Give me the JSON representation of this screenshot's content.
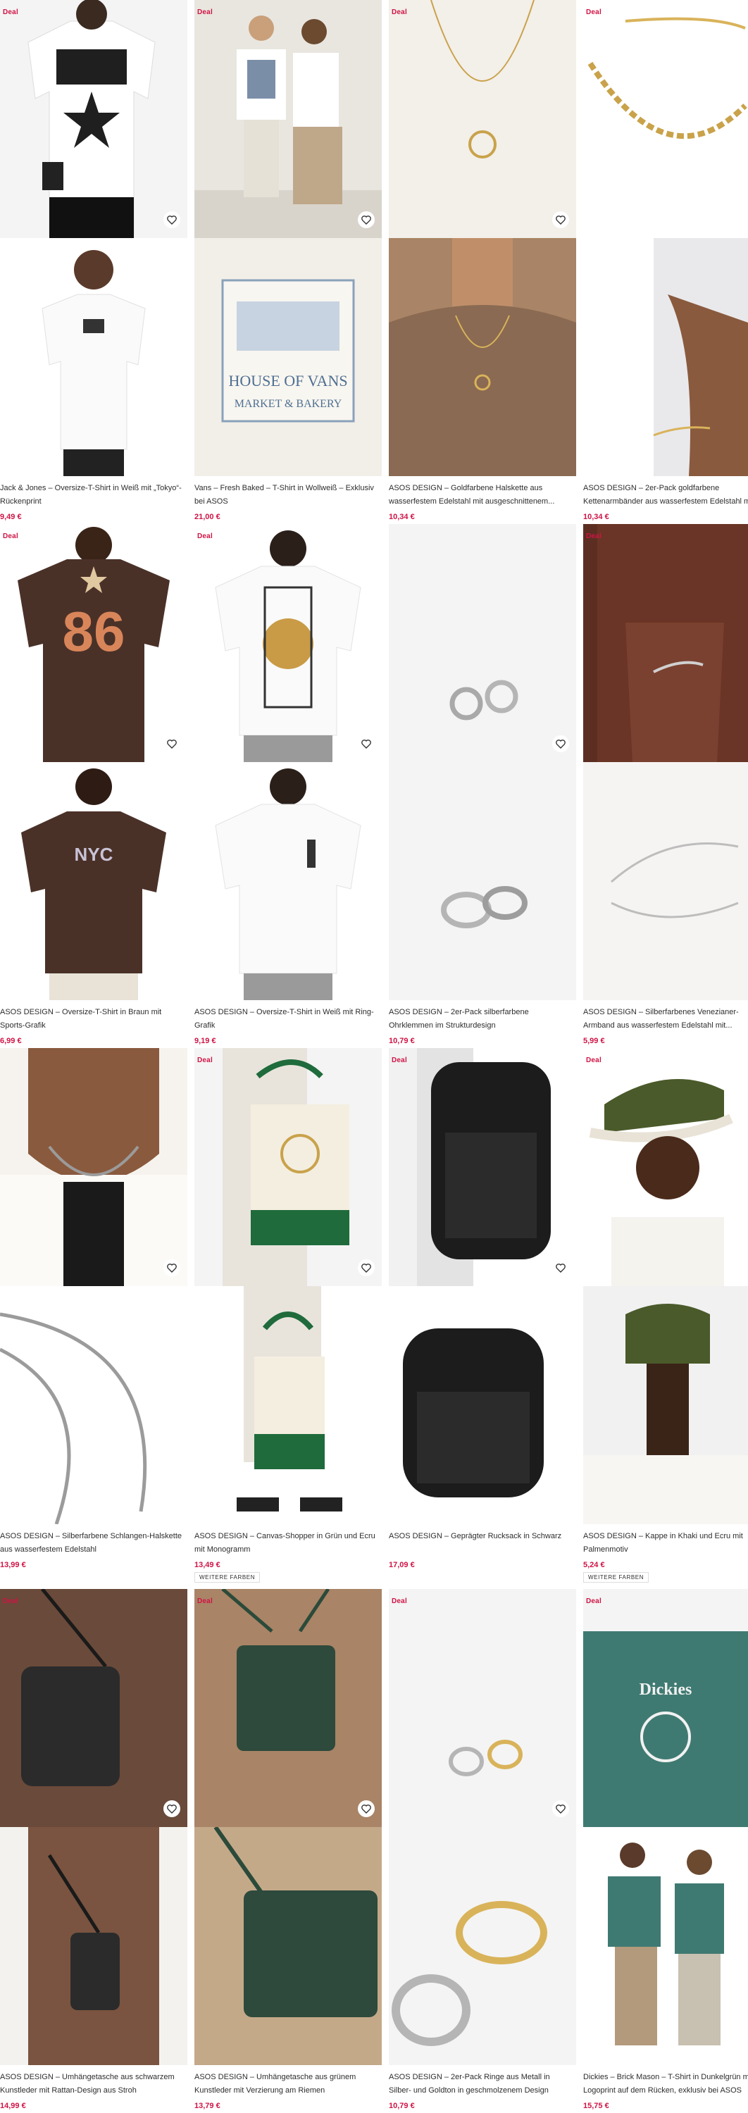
{
  "products": [
    {
      "deal": "Deal",
      "title": "Jack & Jones – Oversize-T-Shirt in Weiß mit „Tokyo“-Rückenprint",
      "price": "9,49 €"
    },
    {
      "deal": "Deal",
      "title": "Vans – Fresh Baked – T-Shirt in Wollweiß – Exklusiv bei ASOS",
      "price": "21,00 €"
    },
    {
      "deal": "Deal",
      "title": "ASOS DESIGN – Goldfarbene Halskette aus wasserfestem Edelstahl mit ausgeschnittenem...",
      "price": "10,34 €"
    },
    {
      "deal": "Deal",
      "title": "ASOS DESIGN – 2er-Pack goldfarbene Kettenarmbänder aus wasserfestem Edelstahl mit...",
      "price": "10,34 €"
    },
    {
      "deal": "Deal",
      "title": "ASOS DESIGN – Oversize-T-Shirt in Braun mit Sports-Grafik",
      "price": "6,99 €"
    },
    {
      "deal": "Deal",
      "title": "ASOS DESIGN – Oversize-T-Shirt in Weiß mit Ring-Grafik",
      "price": "9,19 €"
    },
    {
      "deal": "",
      "title": "ASOS DESIGN – 2er-Pack silberfarbene Ohrklemmen im Strukturdesign",
      "price": "10,79 €"
    },
    {
      "deal": "Deal",
      "title": "ASOS DESIGN – Silberfarbenes Venezianer-Armband aus wasserfestem Edelstahl mit...",
      "price": "5,99 €"
    },
    {
      "deal": "",
      "title": "ASOS DESIGN – Silberfarbene Schlangen-Halskette aus wasserfestem Edelstahl",
      "price": "13,99 €"
    },
    {
      "deal": "Deal",
      "title": "ASOS DESIGN – Canvas-Shopper in Grün und Ecru mit Monogramm",
      "price": "13,49 €",
      "more_colors": "WEITERE FARBEN"
    },
    {
      "deal": "Deal",
      "title": "ASOS DESIGN – Geprägter Rucksack in Schwarz",
      "price": "17,09 €"
    },
    {
      "deal": "Deal",
      "title": "ASOS DESIGN – Kappe in Khaki und Ecru mit Palmenmotiv",
      "price": "5,24 €",
      "more_colors": "WEITERE FARBEN"
    },
    {
      "deal": "Deal",
      "title": "ASOS DESIGN – Umhängetasche aus schwarzem Kunstleder mit Rattan-Design aus Stroh",
      "price": "14,99 €"
    },
    {
      "deal": "Deal",
      "title": "ASOS DESIGN – Umhängetasche aus grünem Kunstleder mit Verzierung am Riemen",
      "price": "13,79 €"
    },
    {
      "deal": "Deal",
      "title": "ASOS DESIGN – 2er-Pack Ringe aus Metall in Silber- und Goldton in geschmolzenem Design",
      "price": "10,79 €"
    },
    {
      "deal": "Deal",
      "title": "Dickies – Brick Mason – T-Shirt in Dunkelgrün mit Logoprint auf dem Rücken, exklusiv bei ASOS",
      "price": "15,75 €"
    }
  ],
  "colors": {
    "accent": "#d01345",
    "text": "#2d2d2d"
  }
}
